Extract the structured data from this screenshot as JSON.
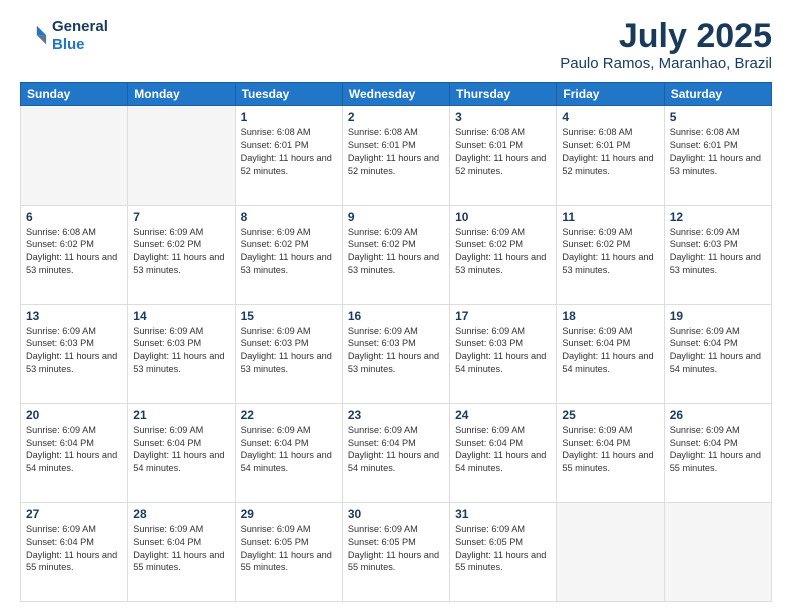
{
  "header": {
    "logo_line1": "General",
    "logo_line2": "Blue",
    "title": "July 2025",
    "subtitle": "Paulo Ramos, Maranhao, Brazil"
  },
  "weekdays": [
    "Sunday",
    "Monday",
    "Tuesday",
    "Wednesday",
    "Thursday",
    "Friday",
    "Saturday"
  ],
  "weeks": [
    [
      {
        "day": "",
        "info": ""
      },
      {
        "day": "",
        "info": ""
      },
      {
        "day": "1",
        "info": "Sunrise: 6:08 AM\nSunset: 6:01 PM\nDaylight: 11 hours and 52 minutes."
      },
      {
        "day": "2",
        "info": "Sunrise: 6:08 AM\nSunset: 6:01 PM\nDaylight: 11 hours and 52 minutes."
      },
      {
        "day": "3",
        "info": "Sunrise: 6:08 AM\nSunset: 6:01 PM\nDaylight: 11 hours and 52 minutes."
      },
      {
        "day": "4",
        "info": "Sunrise: 6:08 AM\nSunset: 6:01 PM\nDaylight: 11 hours and 52 minutes."
      },
      {
        "day": "5",
        "info": "Sunrise: 6:08 AM\nSunset: 6:01 PM\nDaylight: 11 hours and 53 minutes."
      }
    ],
    [
      {
        "day": "6",
        "info": "Sunrise: 6:08 AM\nSunset: 6:02 PM\nDaylight: 11 hours and 53 minutes."
      },
      {
        "day": "7",
        "info": "Sunrise: 6:09 AM\nSunset: 6:02 PM\nDaylight: 11 hours and 53 minutes."
      },
      {
        "day": "8",
        "info": "Sunrise: 6:09 AM\nSunset: 6:02 PM\nDaylight: 11 hours and 53 minutes."
      },
      {
        "day": "9",
        "info": "Sunrise: 6:09 AM\nSunset: 6:02 PM\nDaylight: 11 hours and 53 minutes."
      },
      {
        "day": "10",
        "info": "Sunrise: 6:09 AM\nSunset: 6:02 PM\nDaylight: 11 hours and 53 minutes."
      },
      {
        "day": "11",
        "info": "Sunrise: 6:09 AM\nSunset: 6:02 PM\nDaylight: 11 hours and 53 minutes."
      },
      {
        "day": "12",
        "info": "Sunrise: 6:09 AM\nSunset: 6:03 PM\nDaylight: 11 hours and 53 minutes."
      }
    ],
    [
      {
        "day": "13",
        "info": "Sunrise: 6:09 AM\nSunset: 6:03 PM\nDaylight: 11 hours and 53 minutes."
      },
      {
        "day": "14",
        "info": "Sunrise: 6:09 AM\nSunset: 6:03 PM\nDaylight: 11 hours and 53 minutes."
      },
      {
        "day": "15",
        "info": "Sunrise: 6:09 AM\nSunset: 6:03 PM\nDaylight: 11 hours and 53 minutes."
      },
      {
        "day": "16",
        "info": "Sunrise: 6:09 AM\nSunset: 6:03 PM\nDaylight: 11 hours and 53 minutes."
      },
      {
        "day": "17",
        "info": "Sunrise: 6:09 AM\nSunset: 6:03 PM\nDaylight: 11 hours and 54 minutes."
      },
      {
        "day": "18",
        "info": "Sunrise: 6:09 AM\nSunset: 6:04 PM\nDaylight: 11 hours and 54 minutes."
      },
      {
        "day": "19",
        "info": "Sunrise: 6:09 AM\nSunset: 6:04 PM\nDaylight: 11 hours and 54 minutes."
      }
    ],
    [
      {
        "day": "20",
        "info": "Sunrise: 6:09 AM\nSunset: 6:04 PM\nDaylight: 11 hours and 54 minutes."
      },
      {
        "day": "21",
        "info": "Sunrise: 6:09 AM\nSunset: 6:04 PM\nDaylight: 11 hours and 54 minutes."
      },
      {
        "day": "22",
        "info": "Sunrise: 6:09 AM\nSunset: 6:04 PM\nDaylight: 11 hours and 54 minutes."
      },
      {
        "day": "23",
        "info": "Sunrise: 6:09 AM\nSunset: 6:04 PM\nDaylight: 11 hours and 54 minutes."
      },
      {
        "day": "24",
        "info": "Sunrise: 6:09 AM\nSunset: 6:04 PM\nDaylight: 11 hours and 54 minutes."
      },
      {
        "day": "25",
        "info": "Sunrise: 6:09 AM\nSunset: 6:04 PM\nDaylight: 11 hours and 55 minutes."
      },
      {
        "day": "26",
        "info": "Sunrise: 6:09 AM\nSunset: 6:04 PM\nDaylight: 11 hours and 55 minutes."
      }
    ],
    [
      {
        "day": "27",
        "info": "Sunrise: 6:09 AM\nSunset: 6:04 PM\nDaylight: 11 hours and 55 minutes."
      },
      {
        "day": "28",
        "info": "Sunrise: 6:09 AM\nSunset: 6:04 PM\nDaylight: 11 hours and 55 minutes."
      },
      {
        "day": "29",
        "info": "Sunrise: 6:09 AM\nSunset: 6:05 PM\nDaylight: 11 hours and 55 minutes."
      },
      {
        "day": "30",
        "info": "Sunrise: 6:09 AM\nSunset: 6:05 PM\nDaylight: 11 hours and 55 minutes."
      },
      {
        "day": "31",
        "info": "Sunrise: 6:09 AM\nSunset: 6:05 PM\nDaylight: 11 hours and 55 minutes."
      },
      {
        "day": "",
        "info": ""
      },
      {
        "day": "",
        "info": ""
      }
    ]
  ]
}
